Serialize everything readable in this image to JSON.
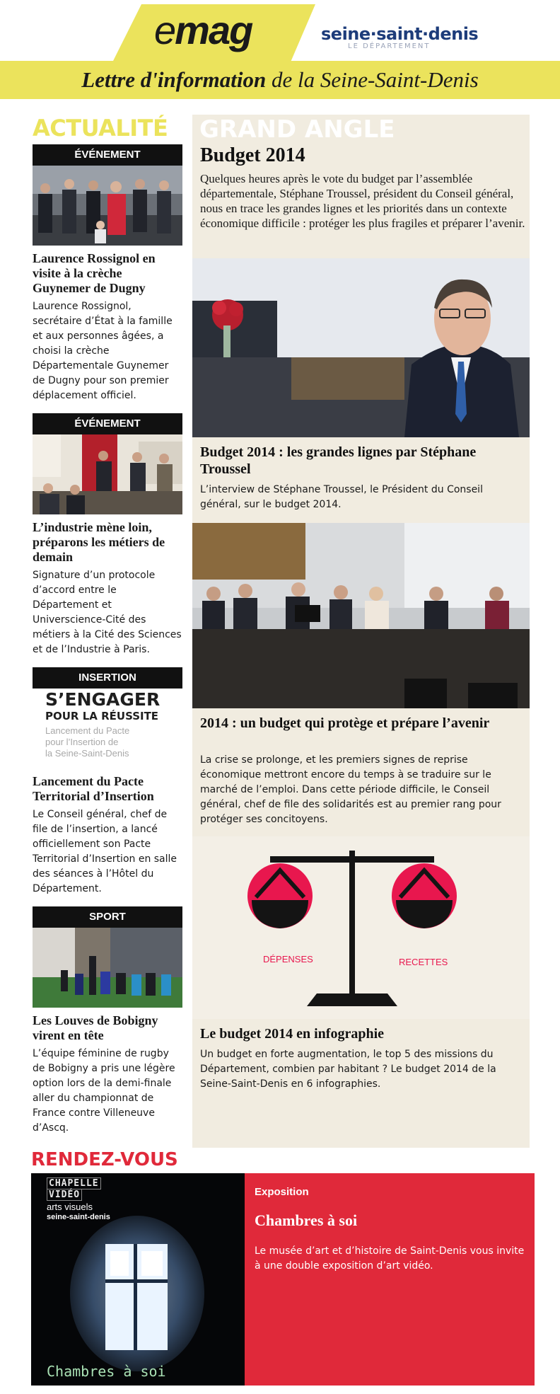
{
  "header": {
    "logo_e": "e",
    "logo_mag": "mag",
    "dept_name": "seine·saint·denis",
    "dept_sub": "LE DÉPARTEMENT",
    "tagline_bold": "Lettre d'information",
    "tagline_rest": " de la Seine-Saint-Denis"
  },
  "actualite": {
    "title": "ACTUALITÉ",
    "articles": [
      {
        "category": "ÉVÉNEMENT",
        "title": "Laurence Rossignol en visite à la crèche Guynemer de Dugny",
        "text": "Laurence Rossignol, secrétaire d’État à la famille et aux personnes âgées, a choisi la crèche Départementale Guynemer de Dugny pour son premier déplacement officiel."
      },
      {
        "category": "ÉVÉNEMENT",
        "title": "L’industrie mène loin, préparons les métiers de demain",
        "text": "Signature d’un protocole d’accord entre le Département et Universcience-Cité des métiers à la Cité des Sciences et de l’Industrie à Paris."
      },
      {
        "category": "INSERTION",
        "title": "Lancement du Pacte Territorial d’Insertion",
        "text": "Le Conseil général, chef de file de l’insertion, a lancé officiellement son Pacte Territorial d’Insertion en salle des séances à l’Hôtel du Département.",
        "image_text": {
          "line1": "S’ENGAGER",
          "line2": "POUR LA RÉUSSITE",
          "line3": "Lancement du Pacte",
          "line4": "pour l’Insertion de",
          "line5": "la Seine-Saint-Denis"
        }
      },
      {
        "category": "SPORT",
        "title": "Les Louves de Bobigny virent en tête",
        "text": "L’équipe féminine de rugby de Bobigny a pris une légère option lors de la demi-finale aller du championnat de France contre Villeneuve d’Ascq."
      }
    ]
  },
  "grand_angle": {
    "title": "GRAND ANGLE",
    "headline": "Budget 2014",
    "intro": "Quelques heures après le vote du budget par l’assemblée départementale, Stéphane Troussel, président du Conseil général, nous en trace les grandes lignes et les priorités dans un contexte économique difficile : protéger les plus fragiles et préparer l’avenir.",
    "items": [
      {
        "title": "Budget 2014 : les grandes lignes par Stéphane Troussel",
        "text": "L’interview de Stéphane Troussel, le Président du Conseil général, sur le budget 2014."
      },
      {
        "title": "2014 : un budget qui protège et prépare l’avenir",
        "text": "La crise se prolonge, et les premiers signes de reprise économique mettront encore du temps à se traduire sur le marché de l’emploi. Dans cette période difficile, le Conseil général, chef de file des solidarités est au premier rang pour protéger ses concitoyens."
      },
      {
        "title": "Le budget 2014 en infographie",
        "text": "Un budget en forte augmentation, le top 5 des missions du Département, combien par habitant ? Le budget 2014 de la Seine-Saint-Denis en 6 infographies.",
        "scale_left": "DÉPENSES",
        "scale_right": "RECETTES"
      }
    ]
  },
  "rendez_vous": {
    "title": "RENDEZ-VOUS",
    "category": "Exposition",
    "headline": "Chambres à soi",
    "text": "Le musée d’art et d’histoire de Saint-Denis vous invite à une double exposition d’art vidéo.",
    "image_text": {
      "line1": "CHAPELLE",
      "line2": "VIDÉO",
      "line3": "arts visuels",
      "line4": "seine-saint-denis",
      "caption": "Chambres à soi"
    }
  },
  "colors": {
    "yellow": "#ebe35c",
    "red": "#e0293a",
    "beige": "#f1ece0",
    "navy": "#1d3c7a"
  }
}
